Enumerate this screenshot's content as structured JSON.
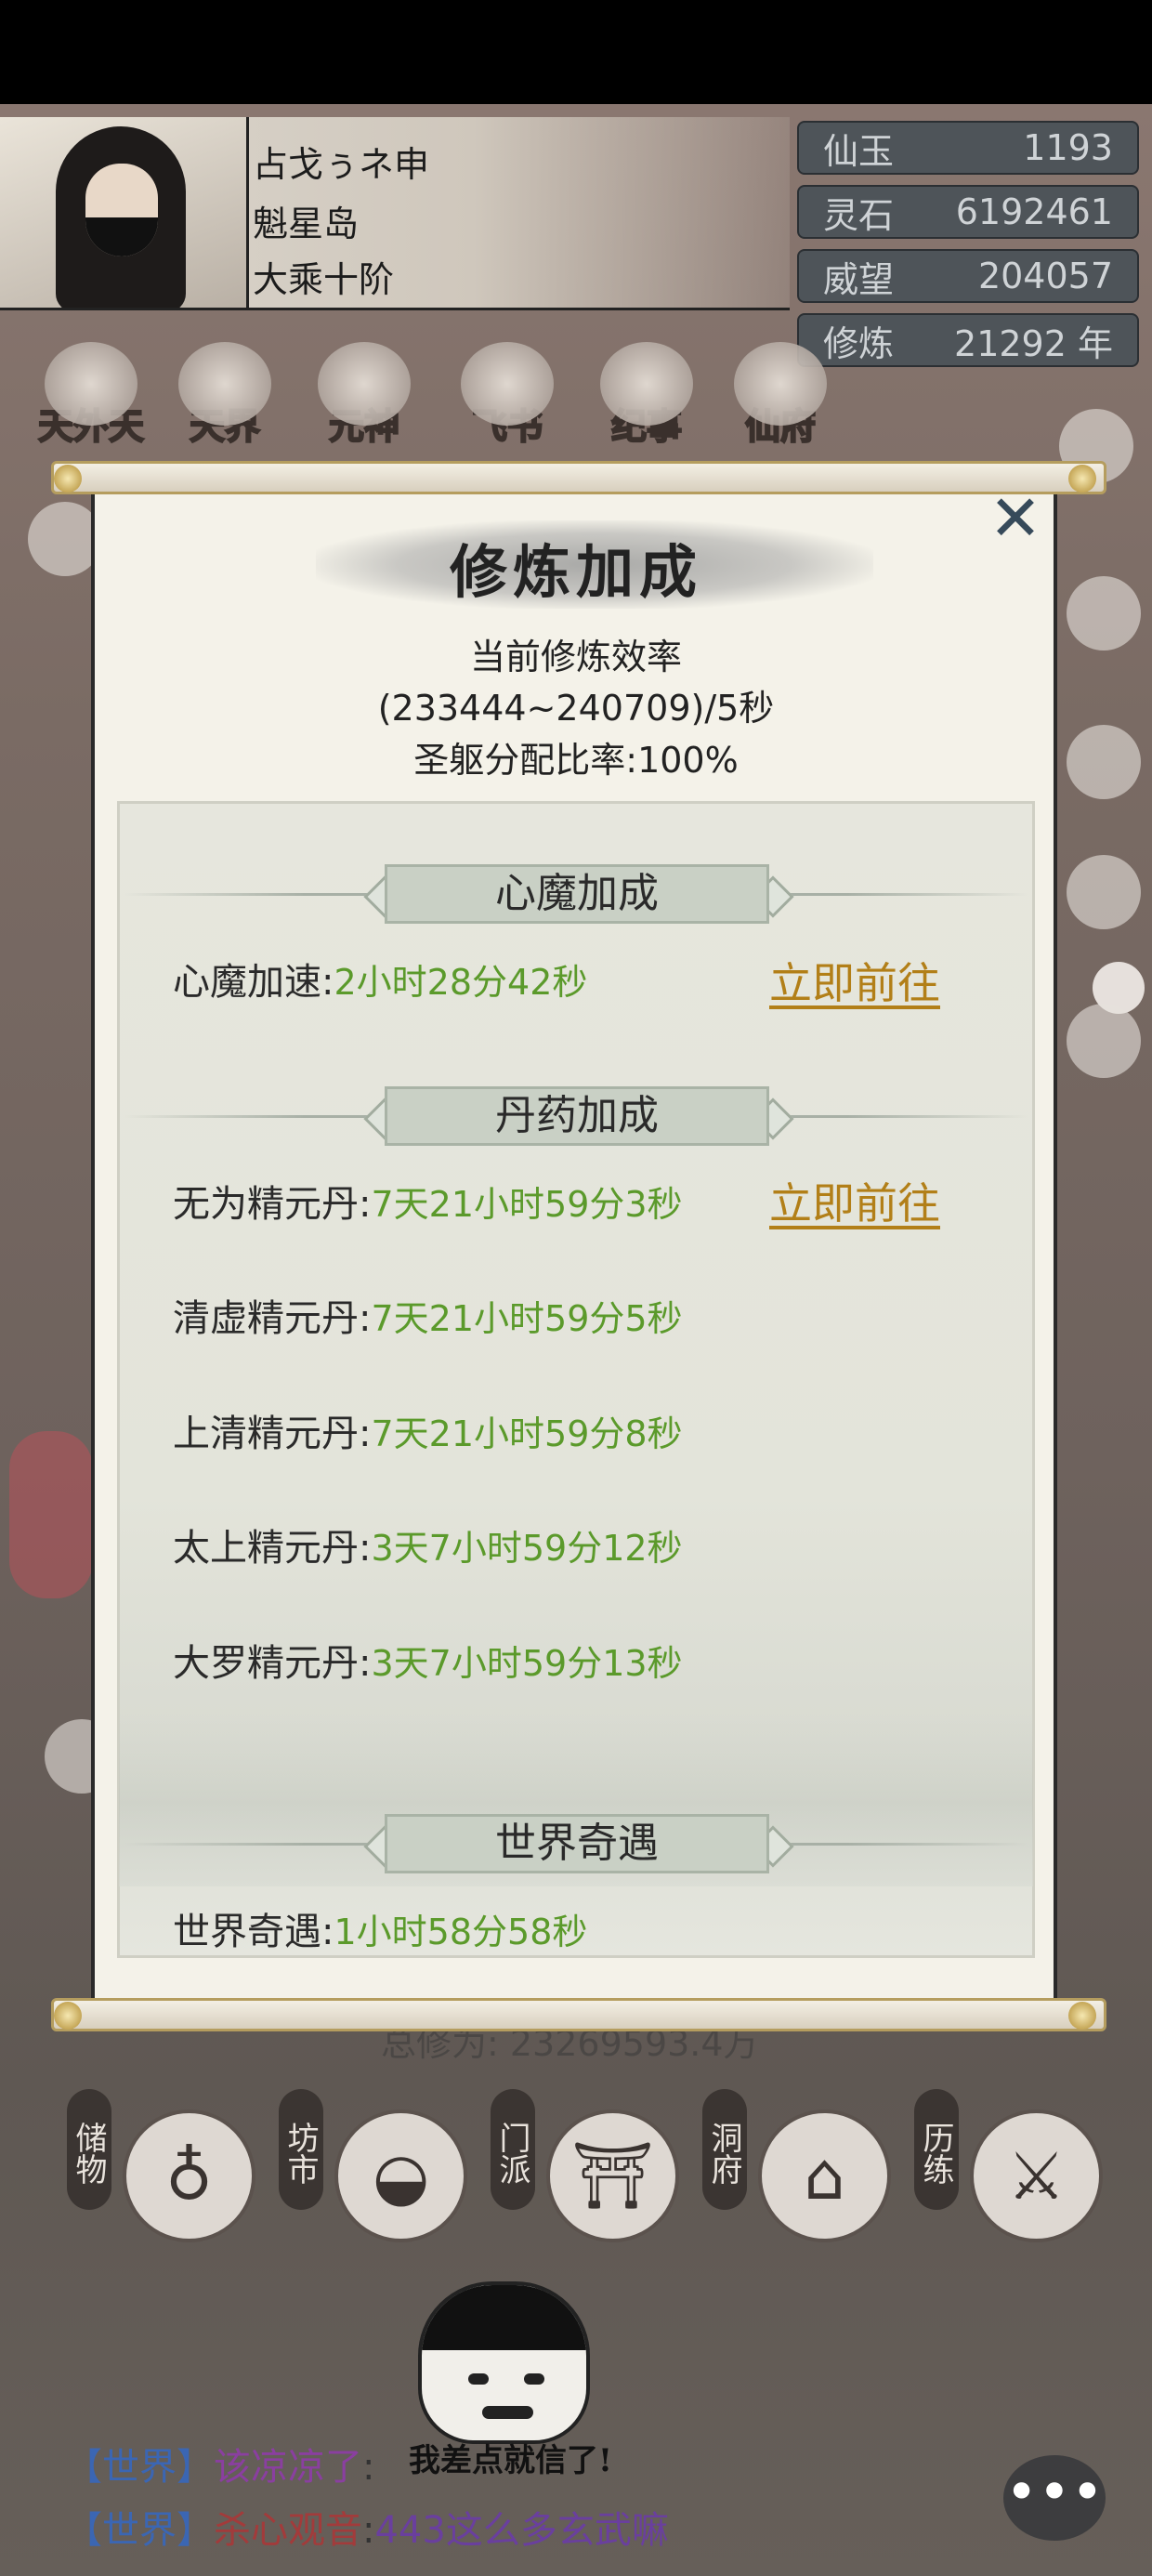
{
  "profile": {
    "name": "占戈ぅネ申",
    "location": "魁星岛",
    "realm": "大乘十阶"
  },
  "resources": [
    {
      "label": "仙玉",
      "value": "1193"
    },
    {
      "label": "灵石",
      "value": "6192461"
    },
    {
      "label": "威望",
      "value": "204057"
    },
    {
      "label": "修炼",
      "value": "21292 年"
    }
  ],
  "top_nav": [
    {
      "label": "天外天",
      "icon": "phoenix-icon"
    },
    {
      "label": "天界",
      "icon": "wings-icon"
    },
    {
      "label": "元神",
      "icon": "spirit-icon"
    },
    {
      "label": "飞书",
      "icon": "envelope-icon"
    },
    {
      "label": "纪事",
      "icon": "scroll-icon"
    },
    {
      "label": "仙府",
      "icon": "pavilion-icon"
    }
  ],
  "behind_modal": {
    "total_cultivation": "总修为: 23269593.4万"
  },
  "bottom_nav": [
    {
      "label": "储物",
      "icon": "bag-icon",
      "glyph": "♁"
    },
    {
      "label": "坊市",
      "icon": "ingot-icon",
      "glyph": "◒"
    },
    {
      "label": "门派",
      "icon": "gate-icon",
      "glyph": "⛩"
    },
    {
      "label": "洞府",
      "icon": "pavilion-icon",
      "glyph": "⌂"
    },
    {
      "label": "历练",
      "icon": "swords-icon",
      "glyph": "⚔"
    }
  ],
  "meme": {
    "caption": "我差点就信了!"
  },
  "chat": [
    {
      "channel": "【世界】",
      "name": "该凉凉了",
      "sep": ":",
      "message": ""
    },
    {
      "channel": "【世界】",
      "name": "杀心观音",
      "sep": ":",
      "message": "443这么多玄武嘛"
    }
  ],
  "modal": {
    "title": "修炼加成",
    "efficiency_label": "当前修炼效率",
    "efficiency_value": "(233444~240709)/5秒",
    "ratio": "圣躯分配比率:100%",
    "close_icon": "close-icon",
    "sections": {
      "heart_demon": {
        "title": "心魔加成",
        "rows": [
          {
            "label": "心魔加速:",
            "value": "2小时28分42秒",
            "action": "立即前往"
          }
        ]
      },
      "pills": {
        "title": "丹药加成",
        "action": "立即前往",
        "rows": [
          {
            "label": "无为精元丹:",
            "value": "7天21小时59分3秒"
          },
          {
            "label": "清虚精元丹:",
            "value": "7天21小时59分5秒"
          },
          {
            "label": "上清精元丹:",
            "value": "7天21小时59分8秒"
          },
          {
            "label": "太上精元丹:",
            "value": "3天7小时59分12秒"
          },
          {
            "label": "大罗精元丹:",
            "value": "3天7小时59分13秒"
          }
        ]
      },
      "world": {
        "title": "世界奇遇",
        "rows": [
          {
            "label": "世界奇遇:",
            "value": "1小时58分58秒"
          }
        ]
      }
    }
  },
  "colors": {
    "value_green": "#5b9a2b",
    "link_gold": "#b27f18",
    "resource_box": "#4e5459"
  }
}
